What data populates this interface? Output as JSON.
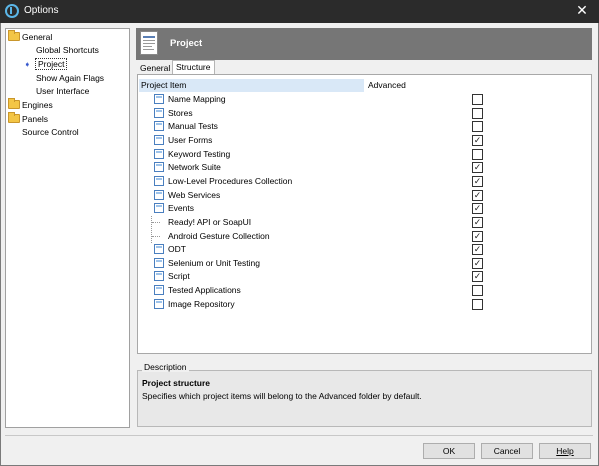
{
  "window": {
    "title": "Options",
    "close_glyph": "✕"
  },
  "tree": {
    "items": [
      {
        "label": "General",
        "icon": "folder-icon"
      },
      {
        "label": "Global Shortcuts"
      },
      {
        "label": "Project",
        "icon": "arrow-right-icon",
        "selected": true
      },
      {
        "label": "Show Again Flags"
      },
      {
        "label": "User Interface"
      },
      {
        "label": "Engines",
        "icon": "folder-icon"
      },
      {
        "label": "Panels",
        "icon": "folder-icon"
      },
      {
        "label": "Source Control"
      }
    ]
  },
  "header": {
    "title": "Project",
    "icon": "project-document-icon"
  },
  "tabs": [
    {
      "label": "General",
      "active": false
    },
    {
      "label": "Structure",
      "active": true
    }
  ],
  "grid": {
    "columns": {
      "name": "Project Item",
      "advanced": "Advanced"
    },
    "rows": [
      {
        "label": "Name Mapping",
        "checked": false,
        "has_icon": true
      },
      {
        "label": "Stores",
        "checked": false,
        "has_icon": true
      },
      {
        "label": "Manual Tests",
        "checked": false,
        "has_icon": true
      },
      {
        "label": "User Forms",
        "checked": true,
        "has_icon": true
      },
      {
        "label": "Keyword Testing",
        "checked": false,
        "has_icon": true
      },
      {
        "label": "Network Suite",
        "checked": true,
        "has_icon": true
      },
      {
        "label": "Low-Level Procedures Collection",
        "checked": true,
        "has_icon": true
      },
      {
        "label": "Web Services",
        "checked": true,
        "has_icon": true
      },
      {
        "label": "Events",
        "checked": true,
        "has_icon": true
      },
      {
        "label": "Ready! API or SoapUI",
        "checked": true,
        "has_icon": false
      },
      {
        "label": "Android Gesture Collection",
        "checked": true,
        "has_icon": false
      },
      {
        "label": "ODT",
        "checked": true,
        "has_icon": true
      },
      {
        "label": "Selenium or Unit Testing",
        "checked": true,
        "has_icon": true
      },
      {
        "label": "Script",
        "checked": true,
        "has_icon": true
      },
      {
        "label": "Tested Applications",
        "checked": false,
        "has_icon": true
      },
      {
        "label": "Image Repository",
        "checked": false,
        "has_icon": true
      }
    ]
  },
  "description": {
    "label": "Description",
    "title": "Project structure",
    "text": "Specifies which project items will belong to the Advanced folder by default."
  },
  "buttons": {
    "ok": "OK",
    "cancel": "Cancel",
    "help": "Help"
  }
}
